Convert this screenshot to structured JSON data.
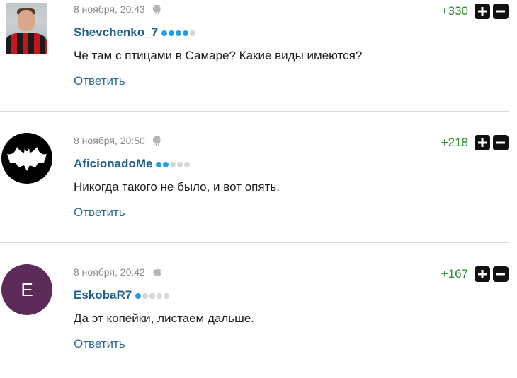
{
  "comments": [
    {
      "date": "8 ноября, 20:43",
      "device_icon": "android-icon",
      "username": "Shevchenko_7",
      "rating_level": 4,
      "text": "Чё там с птицами в Самаре? Какие виды имеются?",
      "reply_label": "Ответить",
      "score": "+330",
      "avatar": "photo"
    },
    {
      "date": "8 ноября, 20:50",
      "device_icon": "android-icon",
      "username": "AficionadoMe",
      "rating_level": 2,
      "text": "Никогда такого не было, и вот опять.",
      "reply_label": "Ответить",
      "score": "+218",
      "avatar": "bat"
    },
    {
      "date": "8 ноября, 20:42",
      "device_icon": "apple-icon",
      "username": "EskobaR7",
      "rating_level": 1,
      "text": "Да эт копейки, листаем дальше.",
      "reply_label": "Ответить",
      "score": "+167",
      "avatar": "letter",
      "avatar_letter": "E"
    }
  ],
  "colors": {
    "username": "#1d5f8a",
    "score": "#2e8b2e",
    "rating_dot_active": "#1fa0e4",
    "avatar_letter_bg": "#5c2b5a"
  }
}
